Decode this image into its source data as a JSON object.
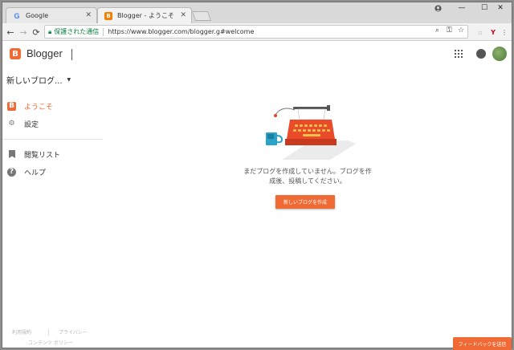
{
  "browser": {
    "tabs": [
      {
        "label": "Google",
        "favicon": "G",
        "close": "✕"
      },
      {
        "label": "Blogger - ようこそ",
        "favicon": "B",
        "close": "✕"
      }
    ],
    "window_controls": {
      "minimize": "—",
      "maximize": "☐",
      "close": "✕"
    },
    "secure_label": "保護された通信",
    "url": "https://www.blogger.com/blogger.g#welcome"
  },
  "header": {
    "app_name": "Blogger",
    "logo_letter": "B"
  },
  "sidebar": {
    "blog_selector": "新しいブログ...",
    "items": [
      {
        "label": "ようこそ",
        "icon": "blogger-icon"
      },
      {
        "label": "設定",
        "icon": "gear-icon"
      },
      {
        "label": "閲覧リスト",
        "icon": "bookmark-icon"
      },
      {
        "label": "ヘルプ",
        "icon": "help-icon"
      }
    ],
    "footer": {
      "terms": "利用規約",
      "privacy": "プライバシー",
      "content_policy": "コンテンツ ポリシー"
    }
  },
  "main": {
    "empty_message_line1": "まだブログを作成していません。ブログを作",
    "empty_message_line2": "成後、投稿してください。",
    "create_button": "新しいブログを作成"
  },
  "feedback_button": "フィードバックを送信",
  "colors": {
    "accent": "#f06a35",
    "secure_green": "#0b8043"
  }
}
